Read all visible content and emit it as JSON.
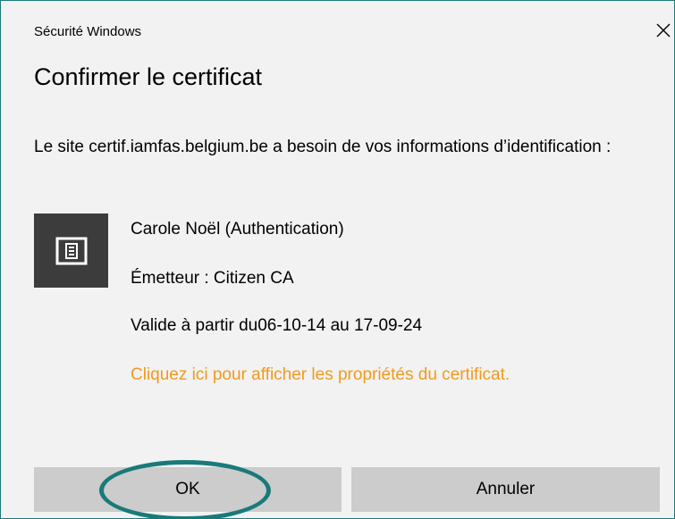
{
  "window": {
    "title": "Sécurité Windows"
  },
  "dialog": {
    "heading": "Confirmer le certificat",
    "message": "Le site certif.iamfas.belgium.be a besoin de vos informations d’identification :"
  },
  "certificate": {
    "icon": "certificate-card-icon",
    "name": "Carole Noël (Authentication)",
    "issuer": "Émetteur : Citizen CA",
    "validity": "Valide à partir du06-10-14 au 17-09-24",
    "properties_link": "Cliquez ici pour afficher les propriétés du certificat."
  },
  "buttons": {
    "ok": "OK",
    "cancel": "Annuler"
  },
  "colors": {
    "accent": "#1a7a7a",
    "link": "#f29a1b",
    "dialog_bg": "#f2f2f2",
    "button_bg": "#cccccc",
    "icon_bg": "#3c3c3c"
  },
  "icons": {
    "close": "close-icon"
  }
}
